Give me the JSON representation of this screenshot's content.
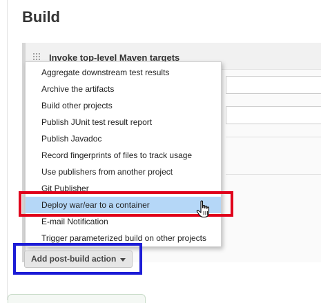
{
  "section": {
    "title": "Build"
  },
  "build_step": {
    "title": "Invoke top-level Maven targets"
  },
  "menu": {
    "items": [
      {
        "label": "Aggregate downstream test results"
      },
      {
        "label": "Archive the artifacts"
      },
      {
        "label": "Build other projects"
      },
      {
        "label": "Publish JUnit test result report"
      },
      {
        "label": "Publish Javadoc"
      },
      {
        "label": "Record fingerprints of files to track usage"
      },
      {
        "label": "Use publishers from another project"
      },
      {
        "label": "Git Publisher"
      },
      {
        "label": "Deploy war/ear to a container"
      },
      {
        "label": "E-mail Notification"
      },
      {
        "label": "Trigger parameterized build on other projects"
      }
    ],
    "highlighted_index": 8
  },
  "add_button": {
    "label": "Add post-build action",
    "icon": "caret-down-icon"
  },
  "annotations": {
    "red_box_color": "#e0001b",
    "blue_box_color": "#1c1cd6"
  },
  "colors": {
    "menu_highlight": "#b5d7f7"
  }
}
